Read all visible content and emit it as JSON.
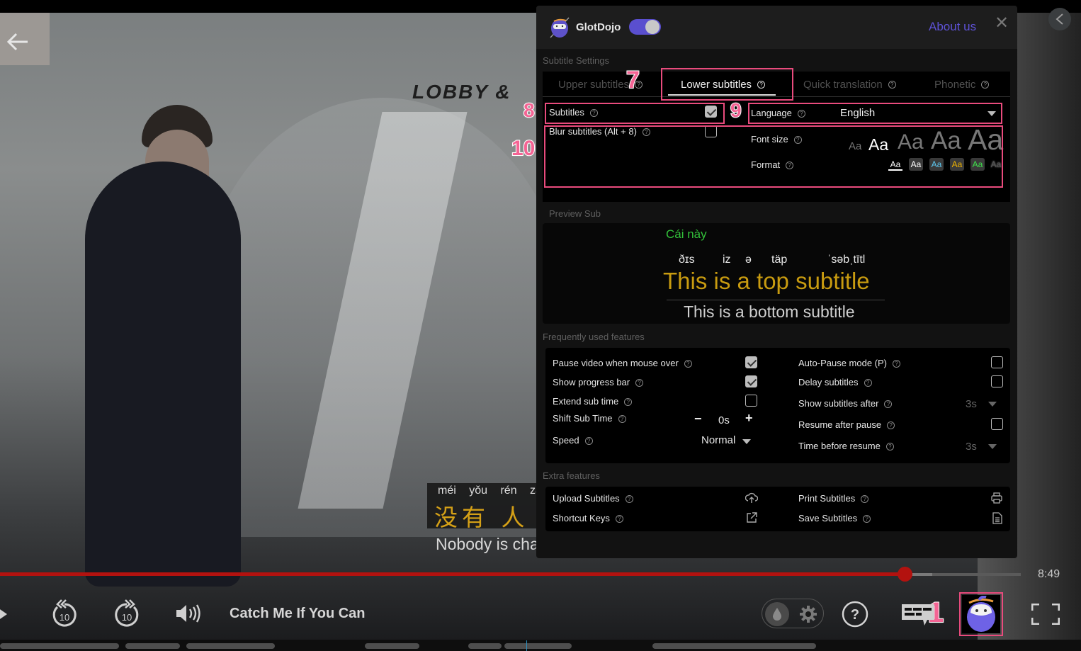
{
  "player": {
    "title": "Catch Me If You Can",
    "time_remaining": "8:49",
    "progress_fraction": 0.886,
    "buffered_fraction": 0.913,
    "scene_sign_text": "LOBBY &",
    "subtitle_overlay": {
      "pinyin": "méi yǒu rén zà",
      "hanzi": "没有 人 在",
      "english": "Nobody is cha"
    }
  },
  "panel": {
    "brand": "GlotDojo",
    "enabled": true,
    "about_label": "About us",
    "close_label": "✕",
    "subtitle_settings_label": "Subtitle Settings",
    "tabs": [
      {
        "label": "Upper subtitles",
        "active": false
      },
      {
        "label": "Lower subtitles",
        "active": true
      },
      {
        "label": "Quick translation",
        "active": false
      },
      {
        "label": "Phonetic",
        "active": false
      }
    ],
    "subtitles_label": "Subtitles",
    "subtitles_checked": true,
    "blur_label": "Blur subtitles (Alt + 8)",
    "blur_checked": false,
    "language_label": "Language",
    "language_value": "English",
    "font_size_label": "Font size",
    "font_size_samples": [
      "Aa",
      "Aa",
      "Aa",
      "Aa",
      "Aa"
    ],
    "font_size_selected_index": 1,
    "format_label": "Format",
    "format_samples": [
      {
        "label": "Aa",
        "color": "#ffffff",
        "bg": "transparent"
      },
      {
        "label": "Aa",
        "color": "#ffffff",
        "bg": "#3a3a3a"
      },
      {
        "label": "Aa",
        "color": "#5ec8f0",
        "bg": "#3a3a3a"
      },
      {
        "label": "Aa",
        "color": "#f0b400",
        "bg": "#3a3a3a"
      },
      {
        "label": "Aa",
        "color": "#3ee04a",
        "bg": "#3a3a3a"
      },
      {
        "label": "Aa",
        "color": "#555555",
        "bg": "transparent"
      }
    ],
    "preview_label": "Preview Sub",
    "preview": {
      "translation": "Cái này",
      "phonetic": [
        "ðɪs",
        "iz",
        "ə",
        "täp",
        "ˈsəbˌtītl"
      ],
      "top": "This is a top subtitle",
      "bottom": "This is a bottom subtitle"
    },
    "frequent_label": "Frequently used features",
    "frequent_left": [
      {
        "label": "Pause video when mouse over",
        "type": "checkbox",
        "checked": true
      },
      {
        "label": "Show progress bar",
        "type": "checkbox",
        "checked": true
      },
      {
        "label": "Extend sub time",
        "type": "checkbox",
        "checked": false
      },
      {
        "label": "Shift Sub Time",
        "type": "stepper",
        "value": "0s",
        "minus": "−",
        "plus": "+"
      },
      {
        "label": "Speed",
        "type": "select",
        "value": "Normal"
      }
    ],
    "frequent_right": [
      {
        "label": "Auto-Pause mode (P)",
        "type": "checkbox",
        "checked": false
      },
      {
        "label": "Delay subtitles",
        "type": "checkbox",
        "checked": false
      },
      {
        "label": "Show subtitles after",
        "type": "select",
        "value": "3s"
      },
      {
        "label": "Resume after pause",
        "type": "checkbox",
        "checked": false
      },
      {
        "label": "Time before resume",
        "type": "select",
        "value": "3s"
      }
    ],
    "extra_label": "Extra features",
    "extra": [
      {
        "label": "Upload Subtitles",
        "icon": "cloud-upload-icon"
      },
      {
        "label": "Print Subtitles",
        "icon": "printer-icon"
      },
      {
        "label": "Shortcut Keys",
        "icon": "external-link-icon"
      },
      {
        "label": "Save Subtitles",
        "icon": "document-icon"
      }
    ]
  },
  "annotations": {
    "n1": "1",
    "n7": "7",
    "n8": "8",
    "n9": "9",
    "n10": "10",
    "color": "#e94b7d"
  }
}
